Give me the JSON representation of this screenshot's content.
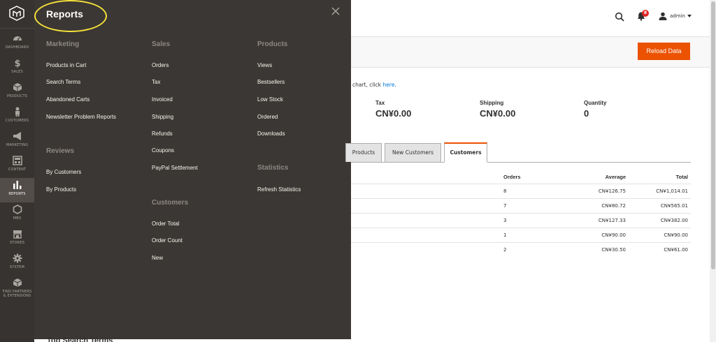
{
  "nav": {
    "items": [
      {
        "label": "DASHBOARD",
        "icon": "dashboard-icon"
      },
      {
        "label": "SALES",
        "icon": "dollar-icon"
      },
      {
        "label": "PRODUCTS",
        "icon": "box-icon"
      },
      {
        "label": "CUSTOMERS",
        "icon": "person-icon"
      },
      {
        "label": "MARKETING",
        "icon": "megaphone-icon"
      },
      {
        "label": "CONTENT",
        "icon": "layout-icon"
      },
      {
        "label": "REPORTS",
        "icon": "bar-chart-icon"
      },
      {
        "label": "MBS",
        "icon": "hexagon-icon"
      },
      {
        "label": "STORES",
        "icon": "store-icon"
      },
      {
        "label": "SYSTEM",
        "icon": "gear-icon"
      },
      {
        "label_line1": "FIND PARTNERS",
        "label_line2": "& EXTENSIONS",
        "icon": "cube-icon"
      }
    ]
  },
  "flyout": {
    "title": "Reports",
    "marketing": {
      "heading": "Marketing",
      "links": [
        "Products in Cart",
        "Search Terms",
        "Abandoned Carts",
        "Newsletter Problem Reports"
      ]
    },
    "reviews": {
      "heading": "Reviews",
      "links": [
        "By Customers",
        "By Products"
      ]
    },
    "sales": {
      "heading": "Sales",
      "links": [
        "Orders",
        "Tax",
        "Invoiced",
        "Shipping",
        "Refunds",
        "Coupons",
        "PayPal Settlement"
      ]
    },
    "customers": {
      "heading": "Customers",
      "links": [
        "Order Total",
        "Order Count",
        "New"
      ]
    },
    "products": {
      "heading": "Products",
      "links": [
        "Views",
        "Bestsellers",
        "Low Stock",
        "Ordered",
        "Downloads"
      ]
    },
    "statistics": {
      "heading": "Statistics",
      "links": [
        "Refresh Statistics"
      ]
    }
  },
  "header": {
    "notification_count": "8",
    "user": "admin"
  },
  "page": {
    "reload_label": "Reload Data",
    "chart_msg_prefix": "chart, click ",
    "chart_msg_link": "here",
    "chart_msg_suffix": "."
  },
  "totals": [
    {
      "label": "Tax",
      "value": "CN¥0.00"
    },
    {
      "label": "Shipping",
      "value": "CN¥0.00"
    },
    {
      "label": "Quantity",
      "value": "0"
    }
  ],
  "tabs": [
    "Products",
    "New Customers",
    "Customers"
  ],
  "table": {
    "headers": {
      "orders": "Orders",
      "average": "Average",
      "total": "Total"
    },
    "rows": [
      {
        "orders": "8",
        "average": "CN¥126.75",
        "total": "CN¥1,014.01"
      },
      {
        "orders": "7",
        "average": "CN¥80.72",
        "total": "CN¥565.01"
      },
      {
        "orders": "3",
        "average": "CN¥127.33",
        "total": "CN¥382.00"
      },
      {
        "orders": "1",
        "average": "CN¥90.00",
        "total": "CN¥90.00"
      },
      {
        "orders": "2",
        "average": "CN¥30.50",
        "total": "CN¥61.00"
      }
    ]
  },
  "bottom_heading": "Top Search Terms",
  "colors": {
    "accent": "#eb5202",
    "nav_bg": "#373330",
    "flyout_bg": "#3b3734",
    "highlight": "#f5e13a"
  }
}
